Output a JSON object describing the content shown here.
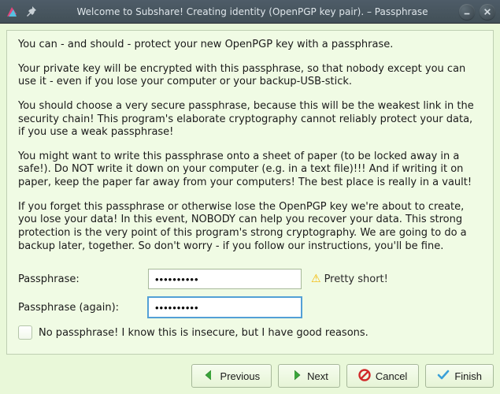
{
  "window": {
    "title": "Welcome to Subshare! Creating identity (OpenPGP key pair). – Passphrase"
  },
  "body": {
    "p1": "You can - and should - protect your new OpenPGP key with a passphrase.",
    "p2": "Your private key will be encrypted with this passphrase, so that nobody except you can use it - even if you lose your computer or your backup-USB-stick.",
    "p3": "You should choose a very secure passphrase, because this will be the weakest link in the security chain! This program's elaborate cryptography cannot reliably protect your data, if you use a weak passphrase!",
    "p4": "You might want to write this passphrase onto a sheet of paper (to be locked away in a safe!). Do NOT write it down on your computer (e.g. in a text file)!!! And if writing it on paper, keep the paper far away from your computers! The best place is really in a vault!",
    "p5": "If you forget this passphrase or otherwise lose the OpenPGP key we're about to create, you lose your data! In this event, NOBODY can help you recover your data. This strong protection is the very point of this program's strong cryptography. We are going to do a backup later, together. So don't worry - if you follow our instructions, you'll be fine."
  },
  "form": {
    "passphrase_label": "Passphrase:",
    "passphrase_again_label": "Passphrase (again):",
    "passphrase_value": "••••••••••",
    "passphrase_again_value": "••••••••••",
    "strength_text": "Pretty short!",
    "nopass_label": "No passphrase! I know this is insecure, but I have good reasons.",
    "nopass_checked": false
  },
  "buttons": {
    "previous": "Previous",
    "next": "Next",
    "cancel": "Cancel",
    "finish": "Finish"
  },
  "colors": {
    "panel_bg": "#f0fbe4",
    "accent_green": "#3aa53a",
    "accent_red": "#d12a2a",
    "accent_blue": "#3aa0d8"
  }
}
